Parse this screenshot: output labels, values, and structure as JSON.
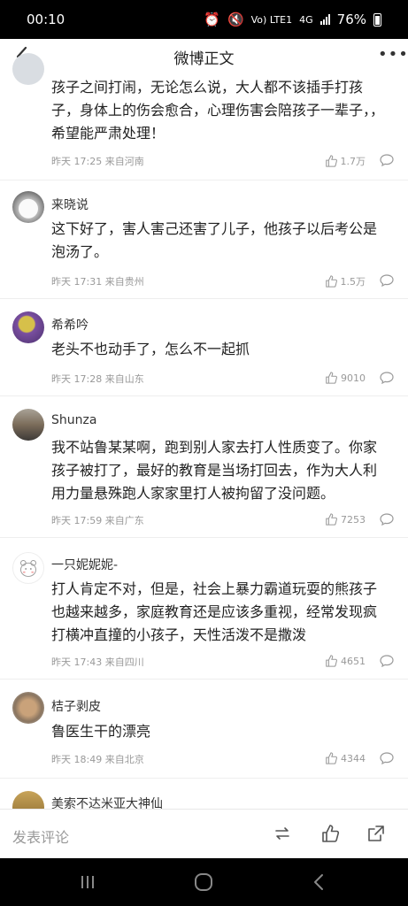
{
  "status_bar": {
    "time": "00:10",
    "network": "Vo) LTE1",
    "signal": "4G",
    "battery": "76%"
  },
  "header": {
    "title": "微博正文"
  },
  "comments": [
    {
      "name": "",
      "text": "孩子之间打闹，无论怎么说，大人都不该插手打孩子，身体上的伤会愈合，心理伤害会陪孩子一辈子，，希望能严肃处理！",
      "meta": "昨天 17:25 来自河南",
      "likes": "1.7万"
    },
    {
      "name": "来晓说",
      "text": "这下好了，害人害己还害了儿子，他孩子以后考公是泡汤了。",
      "meta": "昨天 17:31 来自贵州",
      "likes": "1.5万"
    },
    {
      "name": "希希吟",
      "text": "老头不也动手了，怎么不一起抓",
      "meta": "昨天 17:28 来自山东",
      "likes": "9010"
    },
    {
      "name": "Shunza",
      "text": "我不站鲁某某啊，跑到别人家去打人性质变了。你家孩子被打了，最好的教育是当场打回去，作为大人利用力量悬殊跑人家家里打人被拘留了没问题。",
      "meta": "昨天 17:59 来自广东",
      "likes": "7253"
    },
    {
      "name": "一只妮妮妮-",
      "text": "打人肯定不对，但是，社会上暴力霸道玩耍的熊孩子也越来越多，家庭教育还是应该多重视，经常发现疯打横冲直撞的小孩子，天性活泼不是撒泼",
      "meta": "昨天 17:43 来自四川",
      "likes": "4651"
    },
    {
      "name": "桔子剥皮",
      "text": "鲁医生干的漂亮",
      "meta": "昨天 18:49 来自北京",
      "likes": "4344"
    },
    {
      "name": "美索不达米亚大神仙",
      "text": "",
      "meta": "",
      "likes": ""
    }
  ],
  "bottom_bar": {
    "placeholder": "发表评论"
  },
  "colors": {
    "text": "#222222",
    "meta": "#999999",
    "divider": "#eeeeee",
    "statusbar": "#000000"
  }
}
